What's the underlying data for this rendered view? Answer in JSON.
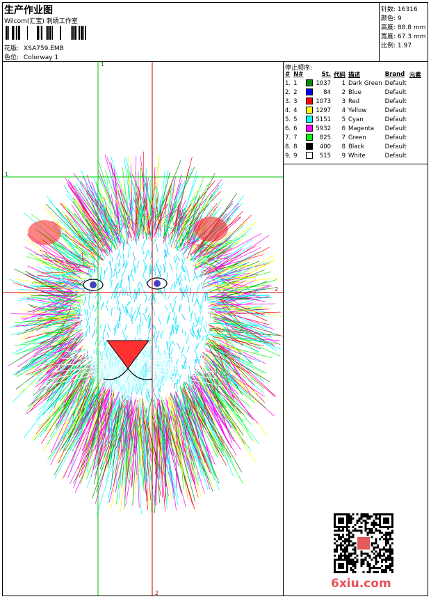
{
  "header": {
    "title": "生产作业图",
    "company": "Wilcom(汇宝) 刺绣工作室",
    "design_label": "花版:",
    "design_value": "XSA759.EMB",
    "colorway_label": "色位:",
    "colorway_value": "Colorway 1"
  },
  "stats": {
    "stitches_label": "针数:",
    "stitches_value": "16316",
    "colors_label": "颜色:",
    "colors_value": "9",
    "height_label": "高度:",
    "height_value": "88.8 mm",
    "width_label": "宽度:",
    "width_value": "67.3 mm",
    "scale_label": "比例:",
    "scale_value": "1.97"
  },
  "color_table": {
    "caption": "停止顺序:",
    "headers": {
      "seq": "#",
      "no": "N#",
      "stitches": "St.",
      "code": "代码",
      "desc": "描述",
      "brand": "Brand",
      "element": "元素"
    },
    "rows": [
      {
        "seq": "1.",
        "no": "1",
        "color": "#0a8a0a",
        "stitches": "1037",
        "code": "1",
        "desc": "Dark Green",
        "brand": "Default"
      },
      {
        "seq": "2.",
        "no": "2",
        "color": "#0000ff",
        "stitches": "84",
        "code": "2",
        "desc": "Blue",
        "brand": "Default"
      },
      {
        "seq": "3.",
        "no": "3",
        "color": "#ff0000",
        "stitches": "1073",
        "code": "3",
        "desc": "Red",
        "brand": "Default"
      },
      {
        "seq": "4.",
        "no": "4",
        "color": "#ffff00",
        "stitches": "1297",
        "code": "4",
        "desc": "Yellow",
        "brand": "Default"
      },
      {
        "seq": "5.",
        "no": "5",
        "color": "#00ffff",
        "stitches": "5151",
        "code": "5",
        "desc": "Cyan",
        "brand": "Default"
      },
      {
        "seq": "6.",
        "no": "6",
        "color": "#ff00ff",
        "stitches": "5932",
        "code": "6",
        "desc": "Magenta",
        "brand": "Default"
      },
      {
        "seq": "7.",
        "no": "7",
        "color": "#00ff00",
        "stitches": "825",
        "code": "7",
        "desc": "Green",
        "brand": "Default"
      },
      {
        "seq": "8.",
        "no": "8",
        "color": "#000000",
        "stitches": "400",
        "code": "8",
        "desc": "Black",
        "brand": "Default"
      },
      {
        "seq": "9.",
        "no": "9",
        "color": "#ffffff",
        "stitches": "515",
        "code": "9",
        "desc": "White",
        "brand": "Default"
      }
    ]
  },
  "guides": {
    "label_1": "1",
    "label_2": "2"
  },
  "watermark": {
    "text": "6xiu.com"
  }
}
